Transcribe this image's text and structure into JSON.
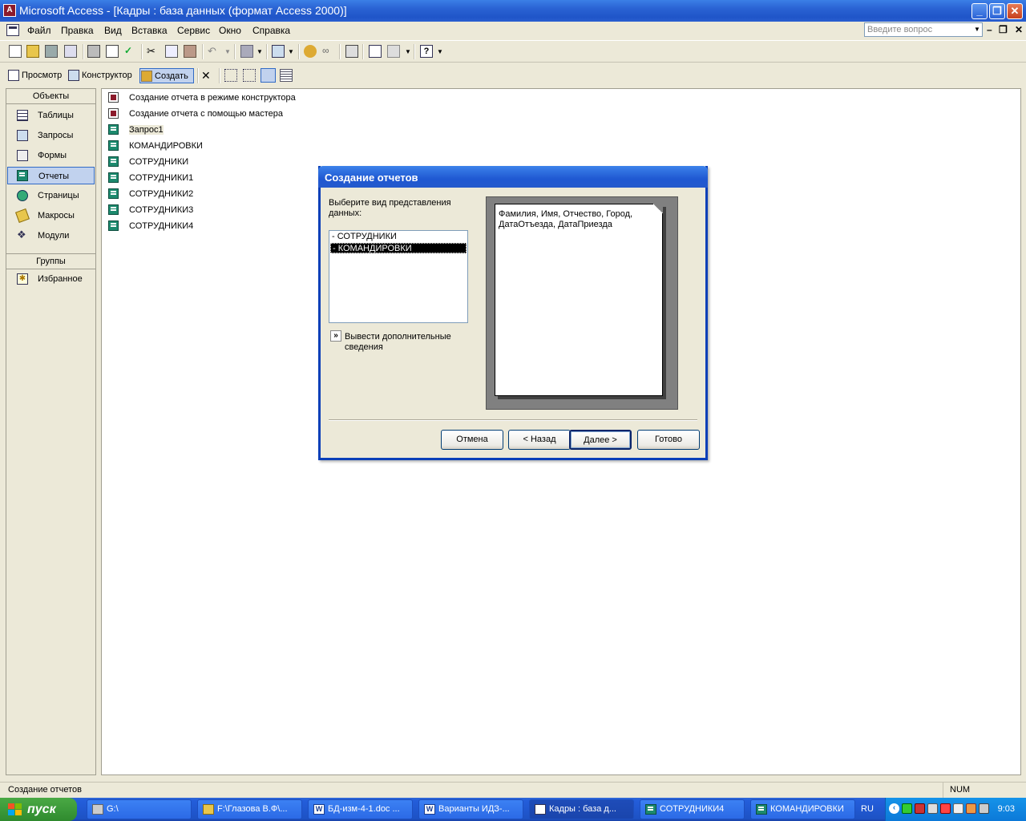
{
  "window": {
    "title": "Microsoft Access - [Кадры : база данных (формат Access 2000)]",
    "app_icon_glyph": "A"
  },
  "menu": {
    "items": [
      "Файл",
      "Правка",
      "Вид",
      "Вставка",
      "Сервис",
      "Окно",
      "Справка"
    ],
    "help_placeholder": "Введите вопрос"
  },
  "db_toolbar": {
    "preview": "Просмотр",
    "design": "Конструктор",
    "create": "Создать"
  },
  "objects_pane": {
    "header": "Объекты",
    "items": [
      "Таблицы",
      "Запросы",
      "Формы",
      "Отчеты",
      "Страницы",
      "Макросы",
      "Модули"
    ],
    "selected": "Отчеты",
    "groups_header": "Группы",
    "groups": [
      "Избранное"
    ]
  },
  "report_list": {
    "items": [
      "Создание отчета в режиме конструктора",
      "Создание отчета с помощью мастера",
      "Запрос1",
      "КОМАНДИРОВКИ",
      "СОТРУДНИКИ",
      "СОТРУДНИКИ1",
      "СОТРУДНИКИ2",
      "СОТРУДНИКИ3",
      "СОТРУДНИКИ4"
    ]
  },
  "dialog": {
    "title": "Создание отчетов",
    "prompt": "Выберите вид представления данных:",
    "options": [
      "- СОТРУДНИКИ",
      "- КОМАНДИРОВКИ"
    ],
    "selected_option": "- КОМАНДИРОВКИ",
    "more_button_glyph": "»",
    "more_label": "Вывести дополнительные сведения",
    "preview_text": "Фамилия, Имя, Отчество, Город, ДатаОтъезда, ДатаПриезда",
    "buttons": {
      "cancel": "Отмена",
      "back": "< Назад",
      "next": "Далее >",
      "finish": "Готово"
    }
  },
  "status": {
    "text": "Создание отчетов",
    "indicator": "NUM"
  },
  "taskbar": {
    "start": "пуск",
    "tasks": [
      "G:\\",
      "F:\\Глазова В.Ф\\...",
      "БД-изм-4-1.doc ...",
      "Варианты ИДЗ-...",
      "Кадры : база д...",
      "СОТРУДНИКИ4",
      "КОМАНДИРОВКИ"
    ],
    "active_task": "Кадры : база д...",
    "lang": "RU",
    "clock": "9:03"
  },
  "colors": {
    "title_blue": "#2a62d3",
    "selection_blue": "#c1d2ee",
    "report_green": "#1d8a6e",
    "start_green": "#3c9a3a"
  }
}
